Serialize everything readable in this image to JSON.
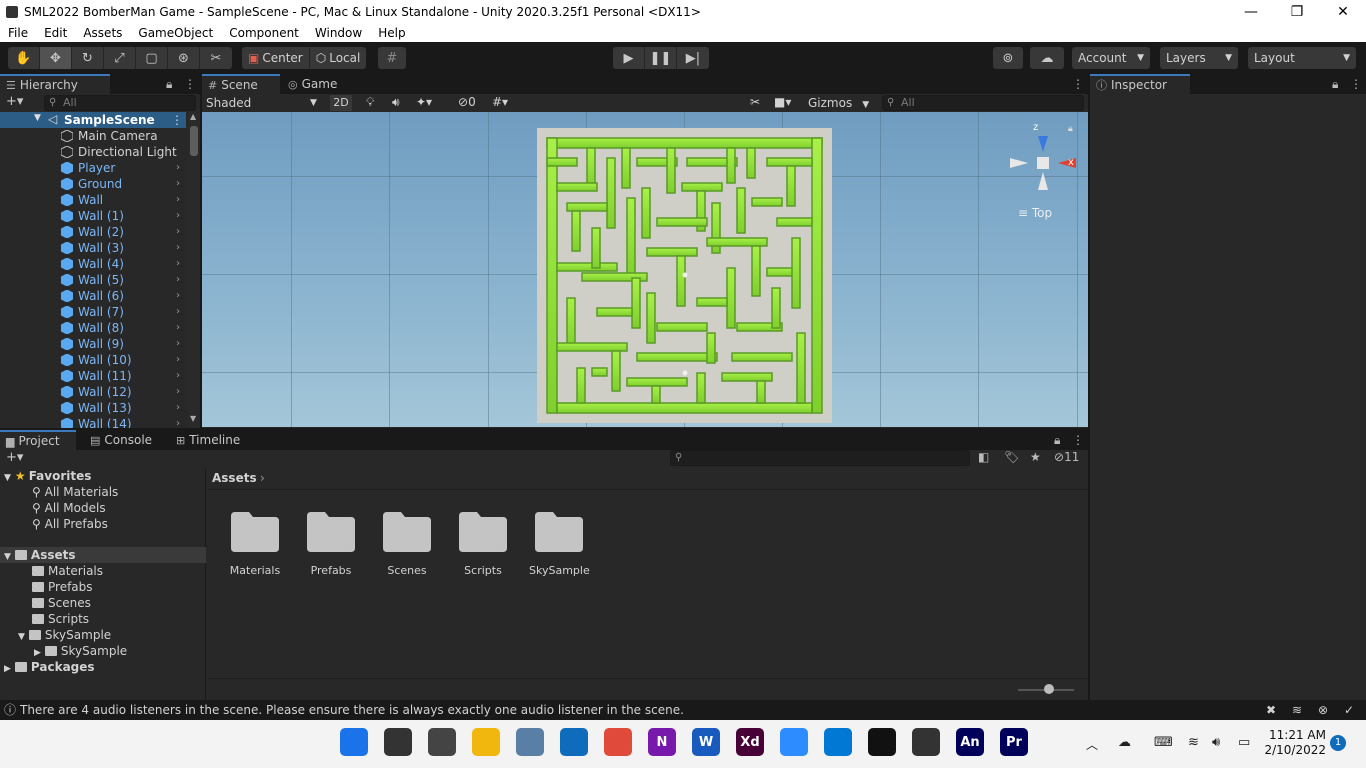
{
  "window": {
    "title": "SML2022 BomberMan Game - SampleScene - PC, Mac & Linux Standalone - Unity 2020.3.25f1 Personal <DX11>",
    "minimize": "—",
    "maximize": "❐",
    "close": "✕"
  },
  "menu": [
    "File",
    "Edit",
    "Assets",
    "GameObject",
    "Component",
    "Window",
    "Help"
  ],
  "toolbar": {
    "pivot": "Center",
    "space": "Local",
    "account": "Account",
    "layers": "Layers",
    "layout": "Layout"
  },
  "hierarchy": {
    "tab": "Hierarchy",
    "search_placeholder": "All",
    "scene": "SampleScene",
    "items": [
      {
        "name": "Main Camera",
        "color": "white"
      },
      {
        "name": "Directional Light",
        "color": "white"
      },
      {
        "name": "Player",
        "color": "blue"
      },
      {
        "name": "Ground",
        "color": "blue"
      },
      {
        "name": "Wall",
        "color": "blue"
      },
      {
        "name": "Wall (1)",
        "color": "blue"
      },
      {
        "name": "Wall (2)",
        "color": "blue"
      },
      {
        "name": "Wall (3)",
        "color": "blue"
      },
      {
        "name": "Wall (4)",
        "color": "blue"
      },
      {
        "name": "Wall (5)",
        "color": "blue"
      },
      {
        "name": "Wall (6)",
        "color": "blue"
      },
      {
        "name": "Wall (7)",
        "color": "blue"
      },
      {
        "name": "Wall (8)",
        "color": "blue"
      },
      {
        "name": "Wall (9)",
        "color": "blue"
      },
      {
        "name": "Wall (10)",
        "color": "blue"
      },
      {
        "name": "Wall (11)",
        "color": "blue"
      },
      {
        "name": "Wall (12)",
        "color": "blue"
      },
      {
        "name": "Wall (13)",
        "color": "blue"
      },
      {
        "name": "Wall (14)",
        "color": "blue"
      }
    ]
  },
  "scene_view": {
    "tab_scene": "Scene",
    "tab_game": "Game",
    "shading": "Shaded",
    "mode_2d": "2D",
    "hidden_count": "0",
    "gizmos": "Gizmos",
    "search_placeholder": "All",
    "gizmo_axis_z": "z",
    "gizmo_axis_x": "x",
    "view_label": "Top"
  },
  "inspector": {
    "tab": "Inspector"
  },
  "project": {
    "tab_project": "Project",
    "tab_console": "Console",
    "tab_timeline": "Timeline",
    "hidden_count": "11",
    "favorites": "Favorites",
    "favorites_items": [
      "All Materials",
      "All Models",
      "All Prefabs"
    ],
    "assets_root": "Assets",
    "assets_tree": [
      "Materials",
      "Prefabs",
      "Scenes",
      "Scripts",
      "SkySample"
    ],
    "skysample_child": "SkySample",
    "packages": "Packages",
    "breadcrumb": "Assets",
    "folders": [
      "Materials",
      "Prefabs",
      "Scenes",
      "Scripts",
      "SkySample"
    ],
    "zoom_level": 0.55
  },
  "status": {
    "message": "There are 4 audio listeners in the scene. Please ensure there is always exactly one audio listener in the scene."
  },
  "taskbar": {
    "apps": [
      {
        "icon": "windows-start-icon",
        "label": "",
        "color": "#1a73e8"
      },
      {
        "icon": "search-icon",
        "label": "",
        "color": "#333333"
      },
      {
        "icon": "task-view-icon",
        "label": "",
        "color": "#444444"
      },
      {
        "icon": "file-explorer-icon",
        "label": "",
        "color": "#f2b70f"
      },
      {
        "icon": "settings-icon",
        "label": "",
        "color": "#5a7fa6"
      },
      {
        "icon": "outlook-icon",
        "label": "",
        "color": "#0f6cbd"
      },
      {
        "icon": "chrome-icon",
        "label": "",
        "color": "#e04a3a"
      },
      {
        "icon": "onenote-icon",
        "label": "N",
        "color": "#7719aa"
      },
      {
        "icon": "word-icon",
        "label": "W",
        "color": "#185abd"
      },
      {
        "icon": "adobe-xd-icon",
        "label": "Xd",
        "color": "#470137"
      },
      {
        "icon": "zoom-icon",
        "label": "",
        "color": "#2d8cff"
      },
      {
        "icon": "vscode-icon",
        "label": "",
        "color": "#0078d4"
      },
      {
        "icon": "unity-icon",
        "label": "",
        "color": "#111111"
      },
      {
        "icon": "unity-hub-icon",
        "label": "",
        "color": "#333333"
      },
      {
        "icon": "adobe-animate-icon",
        "label": "An",
        "color": "#00005b"
      },
      {
        "icon": "adobe-premiere-icon",
        "label": "Pr",
        "color": "#00005b"
      }
    ],
    "time": "11:21 AM",
    "date": "2/10/2022",
    "notifications": "1"
  }
}
